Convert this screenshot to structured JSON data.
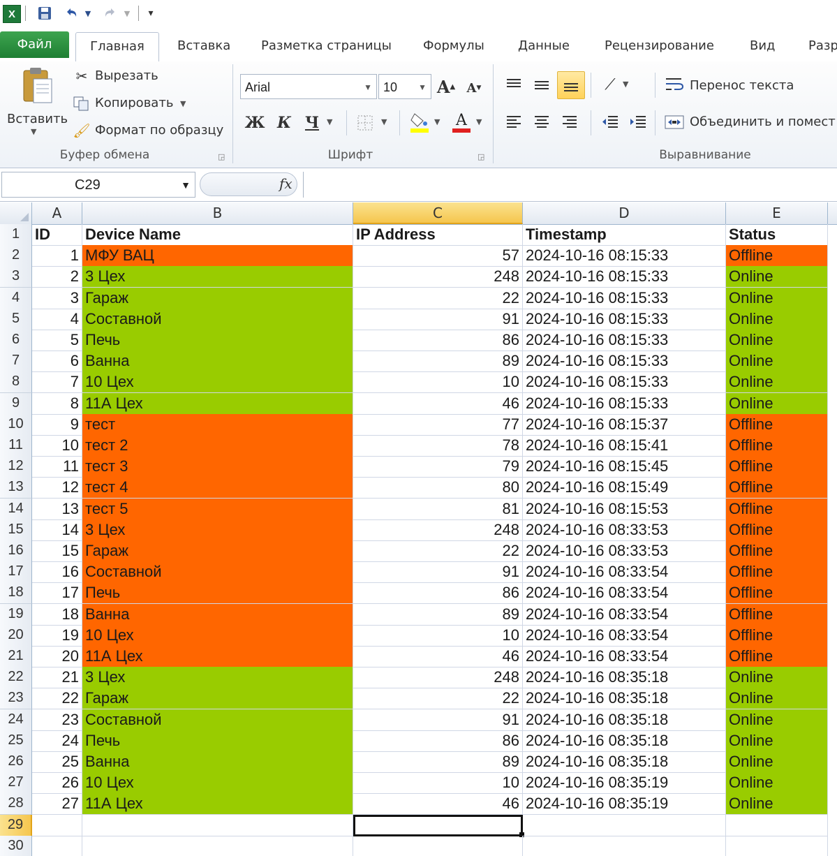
{
  "ribbon_tabs": [
    "Файл",
    "Главная",
    "Вставка",
    "Разметка страницы",
    "Формулы",
    "Данные",
    "Рецензирование",
    "Вид",
    "Разр"
  ],
  "clipboard": {
    "paste": "Вставить",
    "cut": "Вырезать",
    "copy": "Копировать",
    "format_painter": "Формат по образцу",
    "group_label": "Буфер обмена"
  },
  "font": {
    "name": "Arial",
    "size": "10",
    "bold": "Ж",
    "italic": "К",
    "underline": "Ч",
    "font_color_letter": "A",
    "grow_letter": "A",
    "shrink_letter": "A",
    "group_label": "Шрифт",
    "fill_color": "#ffff00",
    "text_color": "#e02020"
  },
  "alignment": {
    "wrap_text": "Перенос текста",
    "merge_center": "Объединить и помест",
    "group_label": "Выравнивание"
  },
  "formula_bar": {
    "name_box": "C29",
    "fx": "fx",
    "value": ""
  },
  "columns": [
    "A",
    "B",
    "C",
    "D",
    "E"
  ],
  "selected": {
    "column": "C",
    "row": 29
  },
  "status_colors": {
    "Online": "#99cc00",
    "Offline": "#ff6600"
  },
  "table": {
    "headers": [
      "ID",
      "Device Name",
      "IP Address",
      "Timestamp",
      "Status"
    ],
    "rows": [
      {
        "id": 1,
        "name": "МФУ ВАЦ",
        "ip": 57,
        "ts": "2024-10-16 08:15:33",
        "status": "Offline"
      },
      {
        "id": 2,
        "name": "3 Цех",
        "ip": 248,
        "ts": "2024-10-16 08:15:33",
        "status": "Online"
      },
      {
        "id": 3,
        "name": "Гараж",
        "ip": 22,
        "ts": "2024-10-16 08:15:33",
        "status": "Online"
      },
      {
        "id": 4,
        "name": "Составной",
        "ip": 91,
        "ts": "2024-10-16 08:15:33",
        "status": "Online"
      },
      {
        "id": 5,
        "name": "Печь",
        "ip": 86,
        "ts": "2024-10-16 08:15:33",
        "status": "Online"
      },
      {
        "id": 6,
        "name": "Ванна",
        "ip": 89,
        "ts": "2024-10-16 08:15:33",
        "status": "Online"
      },
      {
        "id": 7,
        "name": "10 Цех",
        "ip": 10,
        "ts": "2024-10-16 08:15:33",
        "status": "Online"
      },
      {
        "id": 8,
        "name": "11А Цех",
        "ip": 46,
        "ts": "2024-10-16 08:15:33",
        "status": "Online"
      },
      {
        "id": 9,
        "name": "тест",
        "ip": 77,
        "ts": "2024-10-16 08:15:37",
        "status": "Offline"
      },
      {
        "id": 10,
        "name": "тест 2",
        "ip": 78,
        "ts": "2024-10-16 08:15:41",
        "status": "Offline"
      },
      {
        "id": 11,
        "name": "тест 3",
        "ip": 79,
        "ts": "2024-10-16 08:15:45",
        "status": "Offline"
      },
      {
        "id": 12,
        "name": "тест 4",
        "ip": 80,
        "ts": "2024-10-16 08:15:49",
        "status": "Offline"
      },
      {
        "id": 13,
        "name": "тест 5",
        "ip": 81,
        "ts": "2024-10-16 08:15:53",
        "status": "Offline"
      },
      {
        "id": 14,
        "name": "3 Цех",
        "ip": 248,
        "ts": "2024-10-16 08:33:53",
        "status": "Offline"
      },
      {
        "id": 15,
        "name": "Гараж",
        "ip": 22,
        "ts": "2024-10-16 08:33:53",
        "status": "Offline"
      },
      {
        "id": 16,
        "name": "Составной",
        "ip": 91,
        "ts": "2024-10-16 08:33:54",
        "status": "Offline"
      },
      {
        "id": 17,
        "name": "Печь",
        "ip": 86,
        "ts": "2024-10-16 08:33:54",
        "status": "Offline"
      },
      {
        "id": 18,
        "name": "Ванна",
        "ip": 89,
        "ts": "2024-10-16 08:33:54",
        "status": "Offline"
      },
      {
        "id": 19,
        "name": "10 Цех",
        "ip": 10,
        "ts": "2024-10-16 08:33:54",
        "status": "Offline"
      },
      {
        "id": 20,
        "name": "11А Цех",
        "ip": 46,
        "ts": "2024-10-16 08:33:54",
        "status": "Offline"
      },
      {
        "id": 21,
        "name": "3 Цех",
        "ip": 248,
        "ts": "2024-10-16 08:35:18",
        "status": "Online"
      },
      {
        "id": 22,
        "name": "Гараж",
        "ip": 22,
        "ts": "2024-10-16 08:35:18",
        "status": "Online"
      },
      {
        "id": 23,
        "name": "Составной",
        "ip": 91,
        "ts": "2024-10-16 08:35:18",
        "status": "Online"
      },
      {
        "id": 24,
        "name": "Печь",
        "ip": 86,
        "ts": "2024-10-16 08:35:18",
        "status": "Online"
      },
      {
        "id": 25,
        "name": "Ванна",
        "ip": 89,
        "ts": "2024-10-16 08:35:18",
        "status": "Online"
      },
      {
        "id": 26,
        "name": "10 Цех",
        "ip": 10,
        "ts": "2024-10-16 08:35:19",
        "status": "Online"
      },
      {
        "id": 27,
        "name": "11А Цех",
        "ip": 46,
        "ts": "2024-10-16 08:35:19",
        "status": "Online"
      }
    ]
  }
}
